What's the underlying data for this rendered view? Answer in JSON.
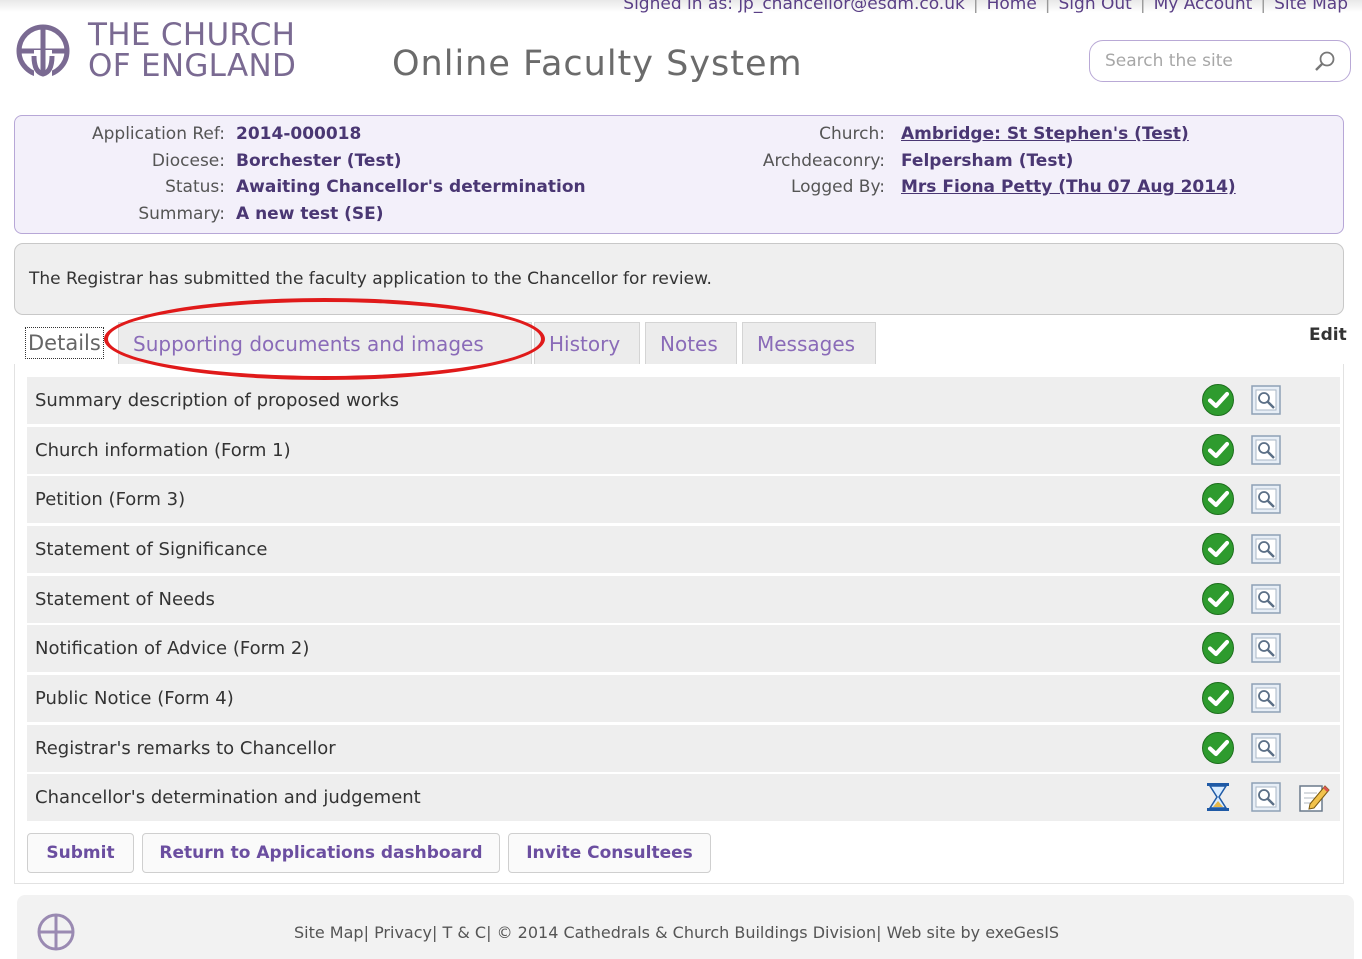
{
  "topnav": {
    "signed_in": "Signed in as: jp_chancellor@esdm.co.uk",
    "home": "Home",
    "sign_out": "Sign Out",
    "my_account": "My Account",
    "site_map": "Site Map"
  },
  "header": {
    "brand_line1": "THE CHURCH",
    "brand_line2": "OF ENGLAND",
    "site_title": "Online Faculty System",
    "search_placeholder": "Search the site"
  },
  "application": {
    "ref_label": "Application Ref:",
    "ref_value": "2014-000018",
    "diocese_label": "Diocese:",
    "diocese_value": "Borchester (Test)",
    "status_label": "Status:",
    "status_value": "Awaiting Chancellor's determination",
    "summary_label": "Summary:",
    "summary_value": "A new test (SE)",
    "church_label": "Church:",
    "church_value": "Ambridge: St Stephen's (Test)",
    "archdeaconry_label": "Archdeaconry:",
    "archdeaconry_value": "Felpersham (Test)",
    "logged_by_label": "Logged By:",
    "logged_by_value": "Mrs Fiona Petty (Thu 07 Aug 2014)"
  },
  "message": "The Registrar has submitted the faculty application to the Chancellor for review.",
  "tabs": [
    "Details",
    "Supporting documents and images",
    "History",
    "Notes",
    "Messages"
  ],
  "edit_label": "Edit",
  "sections": [
    {
      "label": "Summary description of proposed works",
      "status": "complete"
    },
    {
      "label": "Church information (Form 1)",
      "status": "complete"
    },
    {
      "label": "Petition (Form 3)",
      "status": "complete"
    },
    {
      "label": "Statement of Significance",
      "status": "complete"
    },
    {
      "label": "Statement of Needs",
      "status": "complete"
    },
    {
      "label": "Notification of Advice (Form 2)",
      "status": "complete"
    },
    {
      "label": "Public Notice (Form 4)",
      "status": "complete"
    },
    {
      "label": "Registrar's remarks to Chancellor",
      "status": "complete"
    },
    {
      "label": "Chancellor's determination and judgement",
      "status": "pending"
    }
  ],
  "buttons": {
    "submit": "Submit",
    "return": "Return to Applications dashboard",
    "invite": "Invite Consultees"
  },
  "footer": {
    "site_map": "Site Map",
    "privacy": "Privacy",
    "tc": "T & C",
    "copyright": "© 2014 Cathedrals & Church Buildings Division",
    "credit": "Web site by exeGesIS"
  },
  "colors": {
    "accent_purple": "#6b4ea0",
    "panel_bg": "#f3f0fa",
    "panel_border": "#b7a7d7",
    "annotation_red": "#e01a1a",
    "check_green": "#2e9b2e"
  },
  "icons": [
    "cross-logo-icon",
    "search-icon",
    "check-icon",
    "view-icon",
    "hourglass-icon",
    "edit-pencil-icon"
  ]
}
